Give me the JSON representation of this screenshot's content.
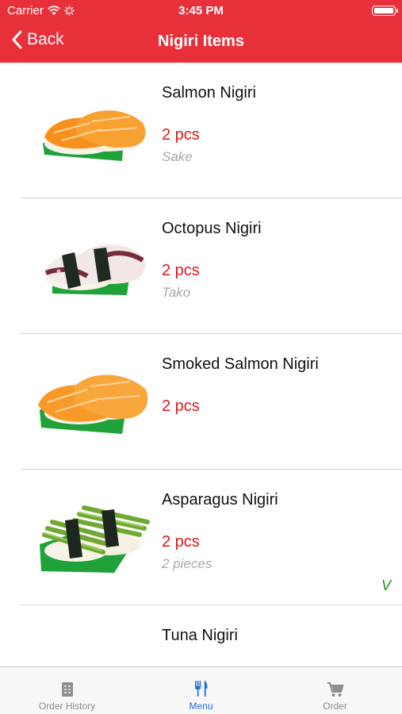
{
  "status_bar": {
    "carrier": "Carrier",
    "time": "3:45 PM"
  },
  "nav": {
    "back_label": "Back",
    "title": "Nigiri Items"
  },
  "colors": {
    "header": "#e8303a",
    "price": "#e0161c",
    "subtitle": "#a9a9a9",
    "veg": "#1e8a1e",
    "tab_active": "#1f6fe0"
  },
  "items": [
    {
      "name": "Salmon Nigiri",
      "qty": "2 pcs",
      "sub": "Sake",
      "badge": ""
    },
    {
      "name": "Octopus Nigiri",
      "qty": "2 pcs",
      "sub": "Tako",
      "badge": ""
    },
    {
      "name": "Smoked Salmon Nigiri",
      "qty": "2 pcs",
      "sub": "",
      "badge": ""
    },
    {
      "name": "Asparagus Nigiri",
      "qty": "2 pcs",
      "sub": "2 pieces",
      "badge": "V"
    },
    {
      "name": "Tuna Nigiri",
      "qty": "",
      "sub": "",
      "badge": ""
    }
  ],
  "tabbar": [
    {
      "label": "Order History",
      "icon": "receipt-icon",
      "active": false
    },
    {
      "label": "Menu",
      "icon": "utensils-icon",
      "active": true
    },
    {
      "label": "Order",
      "icon": "cart-icon",
      "active": false
    }
  ]
}
